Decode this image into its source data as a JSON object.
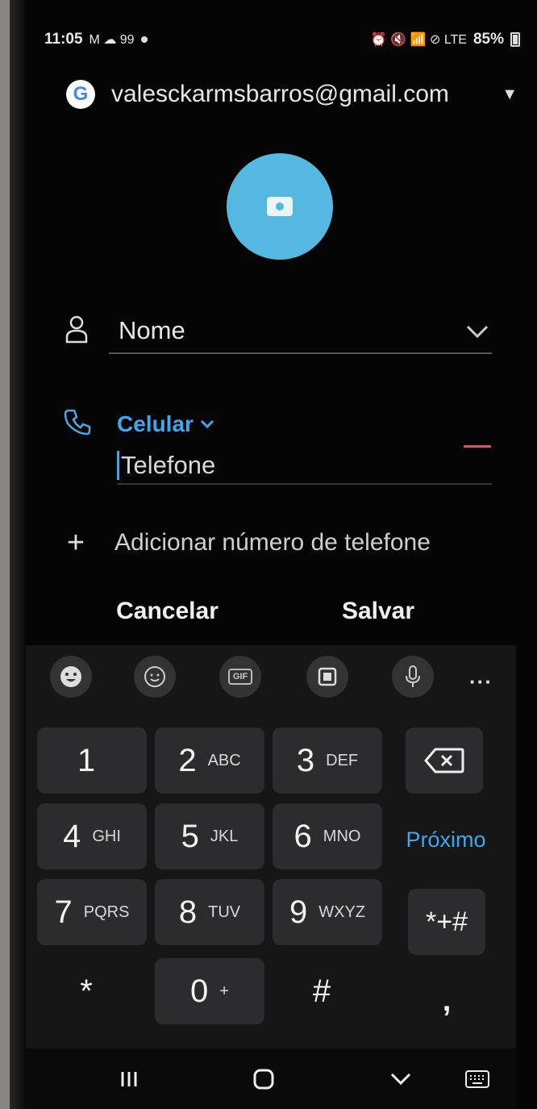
{
  "status_bar": {
    "time": "11:05",
    "left_icons": "M ☁ 99",
    "battery": "85%",
    "right_icons": "⏰ 🔇 📶 ⊘ LTE"
  },
  "account": {
    "email": "valesckarmsbarros@gmail.com",
    "logo_letter": "G"
  },
  "contact_form": {
    "name_placeholder": "Nome",
    "phone_type": "Celular",
    "phone_placeholder": "Telefone",
    "add_phone_label": "Adicionar número de telefone"
  },
  "actions": {
    "cancel_label": "Cancelar",
    "save_label": "Salvar"
  },
  "keyboard": {
    "toolbar_icons": [
      "emoji-icon",
      "sticker-icon",
      "gif-icon",
      "clipboard-icon",
      "microphone-icon",
      "more-icon"
    ],
    "gif_label": "GIF",
    "more_label": "···",
    "keys": [
      {
        "num": "1",
        "letters": ""
      },
      {
        "num": "2",
        "letters": "ABC"
      },
      {
        "num": "3",
        "letters": "DEF"
      },
      {
        "num": "4",
        "letters": "GHI"
      },
      {
        "num": "5",
        "letters": "JKL"
      },
      {
        "num": "6",
        "letters": "MNO"
      },
      {
        "num": "7",
        "letters": "PQRS"
      },
      {
        "num": "8",
        "letters": "TUV"
      },
      {
        "num": "9",
        "letters": "WXYZ"
      },
      {
        "num": "*",
        "letters": ""
      },
      {
        "num": "0",
        "letters": "+"
      },
      {
        "num": "#",
        "letters": ""
      }
    ],
    "next_label": "Próximo",
    "symbols_label": "*+#",
    "comma_label": ","
  },
  "colors": {
    "accent": "#3da8f0",
    "avatar": "#55b8e0",
    "remove": "#e0505e",
    "key_bg": "#2c2c2e"
  }
}
